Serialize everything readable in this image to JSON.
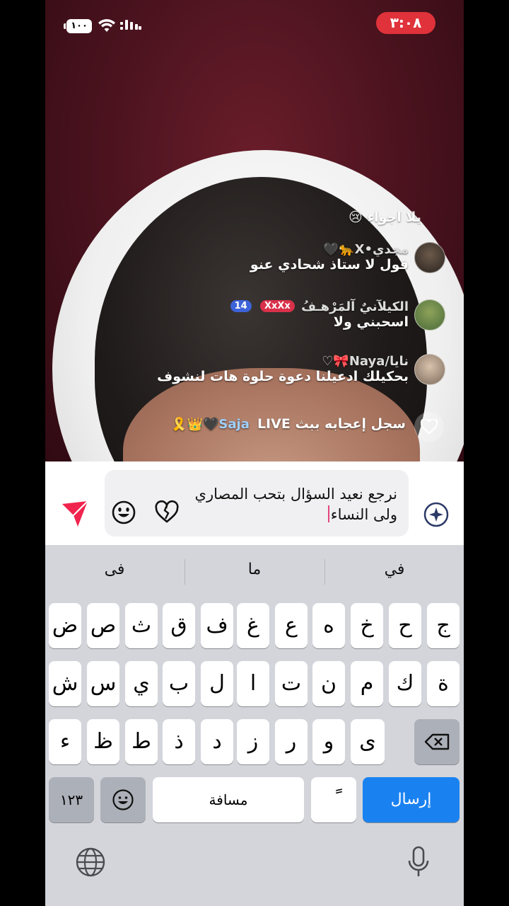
{
  "status_bar": {
    "battery": "١٠٠",
    "time": "٣:٠٨"
  },
  "comments": [
    {
      "name": "",
      "text": "يلا اجواء 😢",
      "partial": true
    },
    {
      "name": "مجدي•X🐆🖤",
      "text": "قول لا ستاذ شحادي عنو"
    },
    {
      "name": "الكيلآنيٌ آلمَرْهـفُ",
      "badge_level": "14",
      "badge_tag": "XxXx",
      "text": "اسحبني ولا"
    },
    {
      "name": "نايا/Naya🎀♡",
      "text": "بحكيلك ادعيلنا دعوة حلوة هات لنشوف"
    },
    {
      "name": "Saja🖤👑🎗️",
      "text": "سجل إعجابه ببث LIVE"
    }
  ],
  "compose": {
    "input_value": "نرجع نعيد السؤال بتحب المصاري ولى النساء"
  },
  "keyboard": {
    "suggestions": [
      "في",
      "ما",
      "فى"
    ],
    "row1": [
      "ج",
      "ح",
      "خ",
      "ه",
      "ع",
      "غ",
      "ف",
      "ق",
      "ث",
      "ص",
      "ض"
    ],
    "row2": [
      "ة",
      "ك",
      "م",
      "ن",
      "ت",
      "ا",
      "ل",
      "ب",
      "ي",
      "س",
      "ش"
    ],
    "row3": [
      "ى",
      "و",
      "ر",
      "ز",
      "د",
      "ذ",
      "ط",
      "ظ",
      "ء"
    ],
    "numbers_key": "١٢٣",
    "space_key": "مسافة",
    "diacritic_key": "ً",
    "send_key": "إرسال"
  },
  "icons": {
    "wifi": "wifi-icon",
    "signal": "signal-icon",
    "heart": "heart-icon",
    "sparkle": "ai-sparkle-icon",
    "broken_heart": "broken-heart-icon",
    "smile": "emoji-icon",
    "send": "send-arrow-icon",
    "backspace": "backspace-icon",
    "globe": "globe-icon",
    "mic": "microphone-icon"
  },
  "colors": {
    "time_pill": "#e0323a",
    "send_arrow": "#f0244e",
    "send_key": "#1a82f0",
    "caret": "#e5457a"
  }
}
